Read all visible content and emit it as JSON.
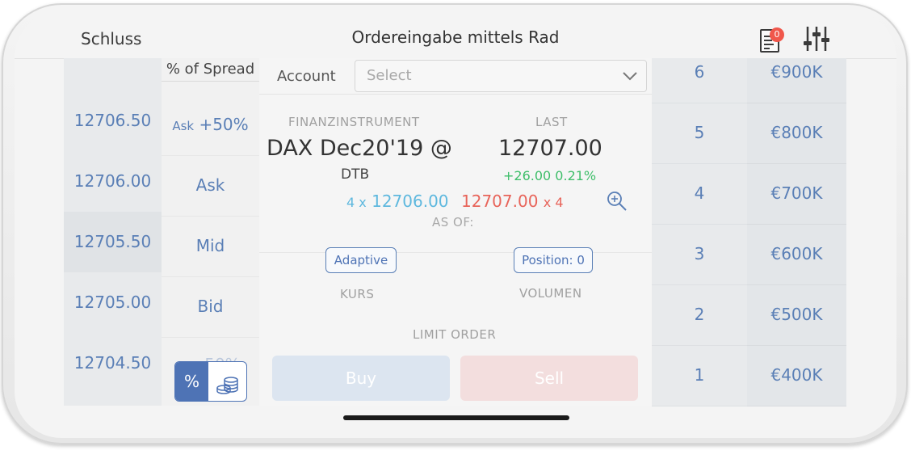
{
  "header": {
    "back_label": "Schluss",
    "title": "Ordereingabe mittels Rad",
    "orders_badge": "0",
    "orders_icon": "orders-list-icon",
    "settings_icon": "sliders-icon"
  },
  "price_ladder": {
    "prices": [
      "12706.50",
      "12706.00",
      "12705.50",
      "12705.00",
      "12704.50"
    ]
  },
  "spread_ladder": {
    "header": "% of Spread",
    "ask_plus_prefix": "Ask",
    "ask_plus_value": "+50%",
    "rows": [
      "Ask",
      "Mid",
      "Bid"
    ],
    "partial_label": "-50%",
    "toggle_percent": "%",
    "toggle_coins_icon": "coins-icon"
  },
  "order_panel": {
    "account_label": "Account",
    "account_placeholder": "Select",
    "instrument_label": "FINANZINSTRUMENT",
    "instrument": "DAX Dec20'19 @",
    "exchange": "DTB",
    "last_label": "LAST",
    "last_value": "12707.00",
    "change": "+26.00 0.21%",
    "bid_qty": "4 x",
    "bid_price": "12706.00",
    "ask_price": "12707.00",
    "ask_qty": "x 4",
    "as_of": "AS OF:",
    "adaptive_label": "Adaptive",
    "position_label": "Position: 0",
    "kurs_label": "KURS",
    "volumen_label": "VOLUMEN",
    "order_type": "LIMIT ORDER",
    "buy_label": "Buy",
    "sell_label": "Sell"
  },
  "volume_ladder": {
    "quantities": [
      "6",
      "5",
      "4",
      "3",
      "2",
      "1"
    ],
    "values": [
      "€900K",
      "€800K",
      "€700K",
      "€600K",
      "€500K",
      "€400K"
    ]
  },
  "colors": {
    "accent": "#4e73b5",
    "bid": "#5eb8de",
    "ask": "#e8645a",
    "change_positive": "#3fbe6a",
    "badge": "#f0574b"
  }
}
